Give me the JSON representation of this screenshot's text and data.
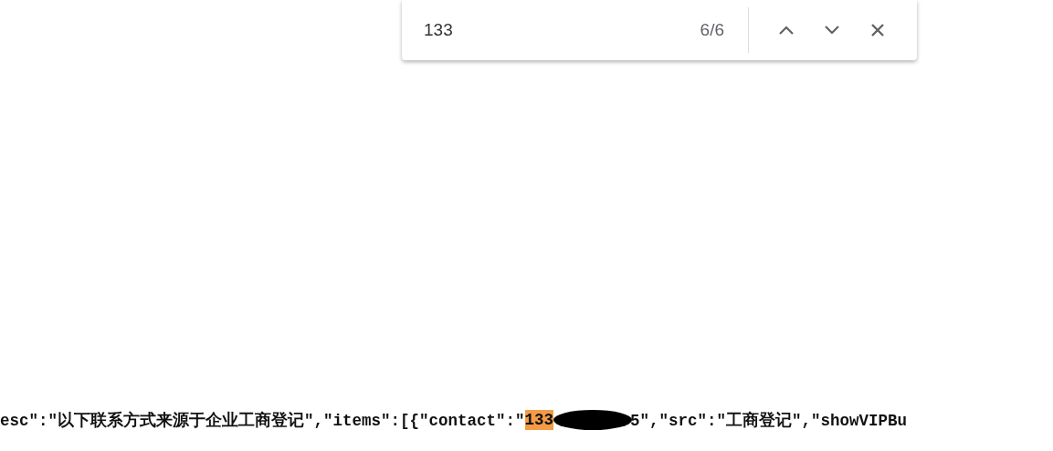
{
  "find_bar": {
    "value": "133",
    "count": "6/6"
  },
  "code_line": {
    "before": "esc\":\"以下联系方式来源于企业工商登记\",\"items\":[{\"contact\":\"",
    "match": "133",
    "after": "5\",\"src\":\"工商登记\",\"showVIPBu"
  }
}
